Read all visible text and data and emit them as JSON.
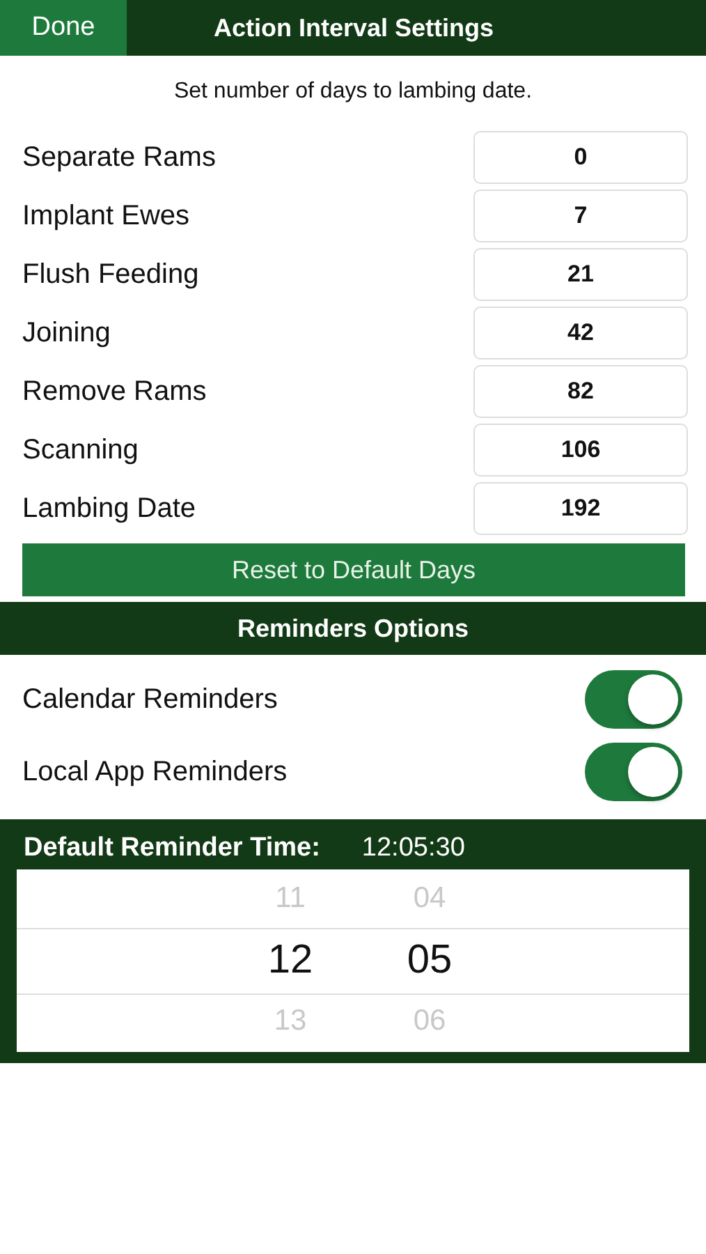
{
  "nav_bar": {
    "done_button": "Done",
    "title": "Action Interval Settings"
  },
  "intro": "Set number of days to lambing date.",
  "intervals": [
    {
      "label": "Separate Rams",
      "value": "0"
    },
    {
      "label": "Implant Ewes",
      "value": "7"
    },
    {
      "label": "Flush Feeding",
      "value": "21"
    },
    {
      "label": "Joining",
      "value": "42"
    },
    {
      "label": "Remove Rams",
      "value": "82"
    },
    {
      "label": "Scanning",
      "value": "106"
    },
    {
      "label": "Lambing Date",
      "value": "192"
    }
  ],
  "reset_button": "Reset to Default Days",
  "reminders_header": "Reminders Options",
  "reminders": [
    {
      "label": "Calendar Reminders",
      "on": true
    },
    {
      "label": "Local App Reminders",
      "on": true
    }
  ],
  "reminder_time": {
    "label": "Default Reminder Time:",
    "value": "12:05:30",
    "picker_columns": [
      {
        "items": [
          {
            "text": "11",
            "selected": false
          },
          {
            "text": "12",
            "selected": true
          },
          {
            "text": "13",
            "selected": false
          }
        ]
      },
      {
        "items": [
          {
            "text": "04",
            "selected": false
          },
          {
            "text": "05",
            "selected": true
          },
          {
            "text": "06",
            "selected": false
          }
        ]
      }
    ]
  }
}
